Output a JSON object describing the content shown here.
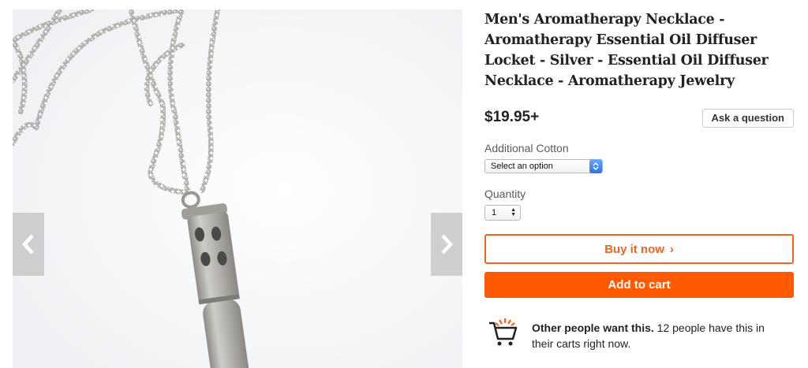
{
  "product": {
    "title": "Men's Aromatherapy Necklace - Aromatherapy Essential Oil Diffuser Locket - Silver - Essential Oil Diffuser Necklace - Aromatherapy Jewelry",
    "price": "$19.95+",
    "ask_question_label": "Ask a question",
    "image_alt": "Silver cylindrical diffuser locket pendant on a ball chain"
  },
  "options": {
    "variation_label": "Additional Cotton",
    "variation_value": "Select an option",
    "quantity_label": "Quantity",
    "quantity_value": "1"
  },
  "actions": {
    "buy_now_label": "Buy it now",
    "buy_now_chevron": "›",
    "add_to_cart_label": "Add to cart"
  },
  "demand": {
    "bold_text": "Other people want this.",
    "text": " 12 people have this in their carts right now."
  },
  "icons": {
    "prev": "chevron-left-icon",
    "next": "chevron-right-icon",
    "cart": "cart-icon"
  },
  "colors": {
    "accent": "#f1641e",
    "add_to_cart_bg": "#ff5a00",
    "arrow_bg": "#c8c8c8"
  }
}
